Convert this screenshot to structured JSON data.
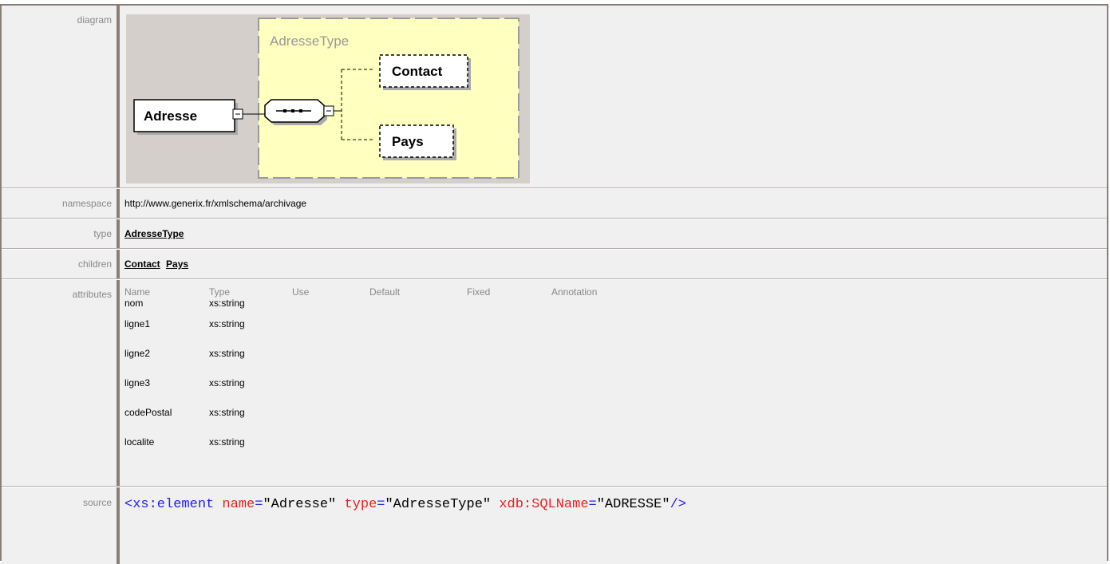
{
  "diagram": {
    "label": "diagram",
    "type_name": "AdresseType",
    "element_name": "Adresse",
    "children": [
      "Contact",
      "Pays"
    ]
  },
  "namespace": {
    "label": "namespace",
    "value": "http://www.generix.fr/xmlschema/archivage"
  },
  "type": {
    "label": "type",
    "value": "AdresseType"
  },
  "children": {
    "label": "children",
    "items": [
      "Contact",
      "Pays"
    ]
  },
  "attributes": {
    "label": "attributes",
    "headers": [
      "Name",
      "Type",
      "Use",
      "Default",
      "Fixed",
      "Annotation"
    ],
    "rows": [
      {
        "name": "nom",
        "type": "xs:string"
      },
      {
        "name": "ligne1",
        "type": "xs:string"
      },
      {
        "name": "ligne2",
        "type": "xs:string"
      },
      {
        "name": "ligne3",
        "type": "xs:string"
      },
      {
        "name": "codePostal",
        "type": "xs:string"
      },
      {
        "name": "localite",
        "type": "xs:string"
      }
    ]
  },
  "source": {
    "label": "source",
    "tag": "<xs:element",
    "attr1_name": "name",
    "attr1_value": "\"Adresse\"",
    "attr2_name": "type",
    "attr2_value": "\"AdresseType\"",
    "attr3_name": "xdb:SQLName",
    "attr3_value": "\"ADRESSE\"",
    "close": "/>"
  },
  "colors": {
    "diagram_bg": "#d5cfcb",
    "type_box_bg": "#ffffc0",
    "border": "#8a7f78",
    "tag": "#2020ee",
    "attr_name": "#e82020"
  }
}
